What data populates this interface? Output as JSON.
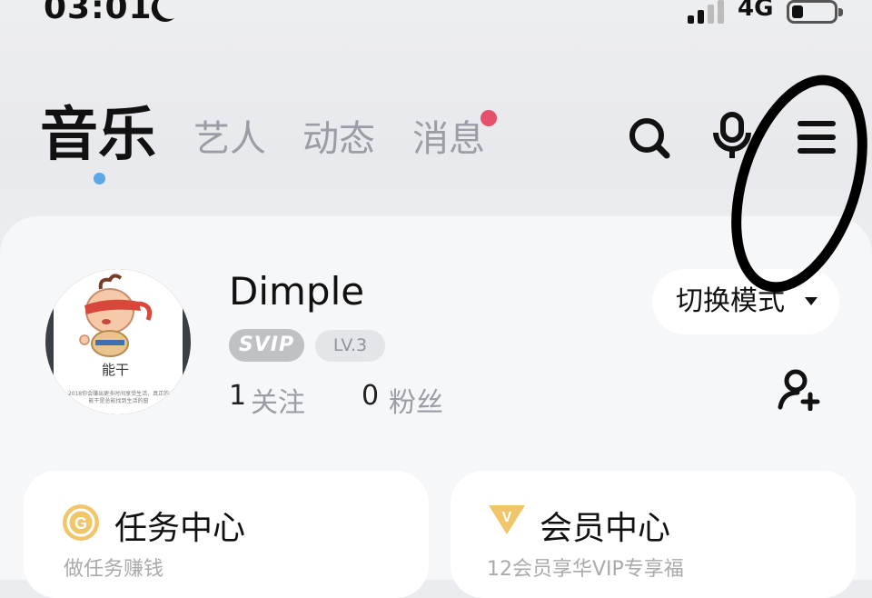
{
  "status": {
    "time": "03:01",
    "network": "4G"
  },
  "tabs": [
    {
      "label": "音乐",
      "active": true
    },
    {
      "label": "艺人",
      "active": false
    },
    {
      "label": "动态",
      "active": false
    },
    {
      "label": "消息",
      "active": false,
      "badge": true
    }
  ],
  "header_icons": [
    "search-icon",
    "microphone-icon",
    "menu-icon"
  ],
  "profile": {
    "avatar_caption": "能干",
    "avatar_small_text": "2018你会赚出更多时间享受生活，真正的能干是总能找到生活的窗",
    "name": "Dimple",
    "badge_svip": "SVIP",
    "badge_level": "LV.3",
    "following_count": "1",
    "following_label": "关注",
    "followers_count": "0",
    "followers_label": "粉丝"
  },
  "mode_button": {
    "label": "切换模式"
  },
  "tiles": [
    {
      "title": "任务中心",
      "subtitle": "做任务赚钱",
      "icon": "coin-g-icon"
    },
    {
      "title": "会员中心",
      "subtitle": "12会员享华VIP专享福",
      "icon": "vip-diamond-icon"
    }
  ],
  "colors": {
    "accent_blue": "#5aa8e6",
    "badge_red": "#e5506a",
    "gold": "#f1c56a"
  }
}
